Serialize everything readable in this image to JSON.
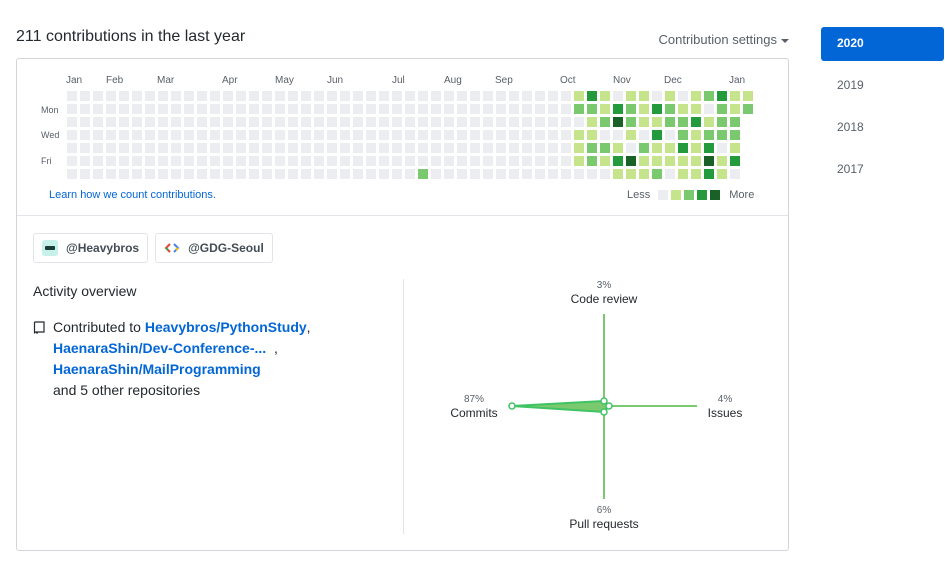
{
  "heading": "211 contributions in the last year",
  "settings_label": "Contribution settings",
  "calendar": {
    "months": [
      "Jan",
      "Feb",
      "Mar",
      "Apr",
      "May",
      "Jun",
      "Jul",
      "Aug",
      "Sep",
      "Oct",
      "Nov",
      "Dec",
      "Jan"
    ],
    "weekdays": [
      "Mon",
      "Wed",
      "Fri"
    ],
    "learn_link": "Learn how we count contributions.",
    "legend_less": "Less",
    "legend_more": "More",
    "colors": [
      "#ebedf0",
      "#c6e48b",
      "#7bc96f",
      "#239a3b",
      "#196127"
    ]
  },
  "orgs": [
    {
      "name": "@Heavybros",
      "icon": "heavybros-logo"
    },
    {
      "name": "@GDG-Seoul",
      "icon": "gdg-logo"
    }
  ],
  "activity": {
    "title": "Activity overview",
    "prefix": "Contributed to",
    "repos": [
      "Heavybros/PythonStudy",
      "HaenaraShin/Dev-Conference-...",
      "HaenaraShin/MailProgramming"
    ],
    "suffix": "and 5 other repositories"
  },
  "radar": {
    "code_review": {
      "label": "Code review",
      "pct": "3%"
    },
    "issues": {
      "label": "Issues",
      "pct": "4%"
    },
    "pull_requests": {
      "label": "Pull requests",
      "pct": "6%"
    },
    "commits": {
      "label": "Commits",
      "pct": "87%"
    }
  },
  "years": [
    "2020",
    "2019",
    "2018",
    "2017"
  ],
  "selected_year": "2020"
}
